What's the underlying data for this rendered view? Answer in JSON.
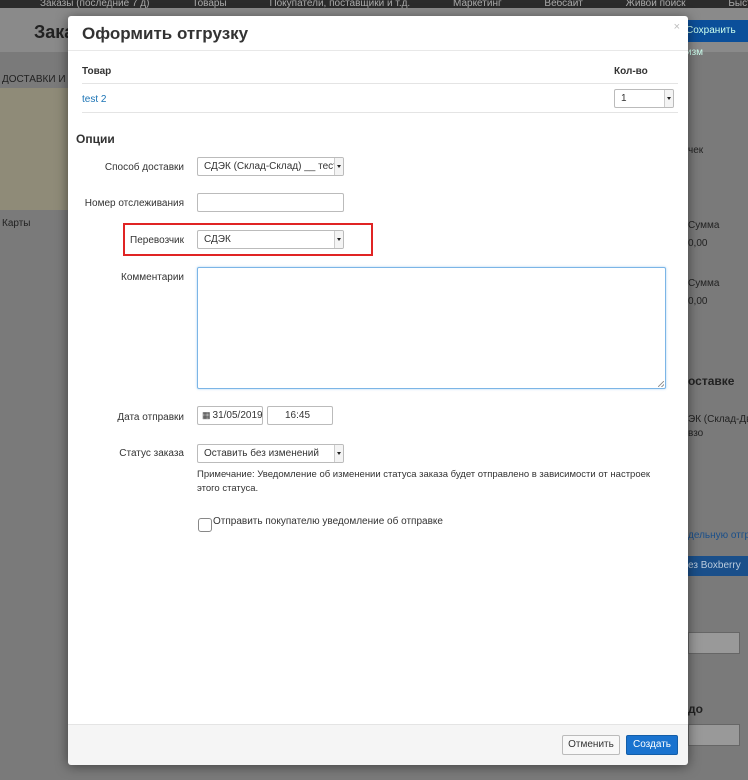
{
  "background": {
    "nav_items": [
      "Заказы (последние 7 д)",
      "Товары",
      "Покупатели, поставщики и т.д.",
      "Маркетинг",
      "Вебсайт",
      "Живой поиск",
      "Быстрое меню"
    ],
    "page_title": "Зака",
    "save_button": "Сохранить изм",
    "map_label_1": "ДОСТАВКИ И КАР",
    "map_label_2": "Карты",
    "right_texts": [
      "чек",
      "Сумма",
      "0,00",
      "Сумма",
      "0,00",
      "оставке",
      "ЭК (Склад-Две",
      "взо",
      "дельную отгру",
      "ез Boxberry",
      "до"
    ]
  },
  "modal": {
    "title": "Оформить отгрузку",
    "close": "×",
    "table": {
      "col_product": "Товар",
      "col_qty": "Кол-во",
      "rows": [
        {
          "product": "test 2",
          "qty": "1"
        }
      ]
    },
    "options_title": "Опции",
    "delivery_method": {
      "label": "Способ доставки",
      "value": "СДЭК (Склад-Склад) __ тесто"
    },
    "tracking": {
      "label": "Номер отслеживания",
      "value": ""
    },
    "carrier": {
      "label": "Перевозчик",
      "value": "СДЭК"
    },
    "comments": {
      "label": "Комментарии",
      "value": ""
    },
    "ship_date": {
      "label": "Дата отправки",
      "date": "31/05/2019",
      "time": "16:45"
    },
    "order_status": {
      "label": "Статус заказа",
      "value": "Оставить без изменений",
      "note": "Примечание: Уведомление об изменении статуса заказа будет отправлено в зависимости от настроек этого статуса."
    },
    "notify": {
      "label": "Отправить покупателю уведомление об отправке",
      "checked": false
    },
    "buttons": {
      "cancel": "Отменить",
      "create": "Создать"
    }
  },
  "colors": {
    "highlight": "#e02424",
    "primary": "#1a73cf",
    "link": "#1a73b5"
  }
}
